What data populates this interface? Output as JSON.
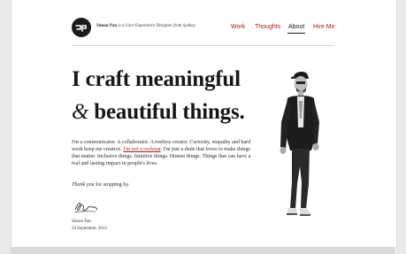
{
  "header": {
    "logo_icon": "sp-monogram-icon",
    "tagline_name": "Simon Pan",
    "tagline_rest": " is a User Experience Designer from Sydney."
  },
  "nav": {
    "items": [
      {
        "label": "Work"
      },
      {
        "label": "Thoughts"
      },
      {
        "label": "About"
      },
      {
        "label": "Hire Me"
      }
    ],
    "active": "About"
  },
  "hero": {
    "line1": "I craft meaningful",
    "amp": "&",
    "line2": " beautiful things."
  },
  "bio": {
    "before_link": "I'm a communicator. A collaborator. A restless creator. Curiosity, empathy and hard work keep me creative. ",
    "link": "I'm not a rockstar",
    "after_link": ". I'm just a dude that loves to make things that matter. Inclusive things. Intuitive things. Honest things. Things that can have a real and lasting impact in people's lives."
  },
  "thanks": {
    "emph": "Thank you",
    "rest": " for stopping by."
  },
  "signoff": {
    "name": "Simon Pan",
    "date": "24 September, 2012"
  },
  "colors": {
    "accent": "#9b1b1b",
    "text": "#1d1d1d",
    "background": "#ffffff"
  }
}
